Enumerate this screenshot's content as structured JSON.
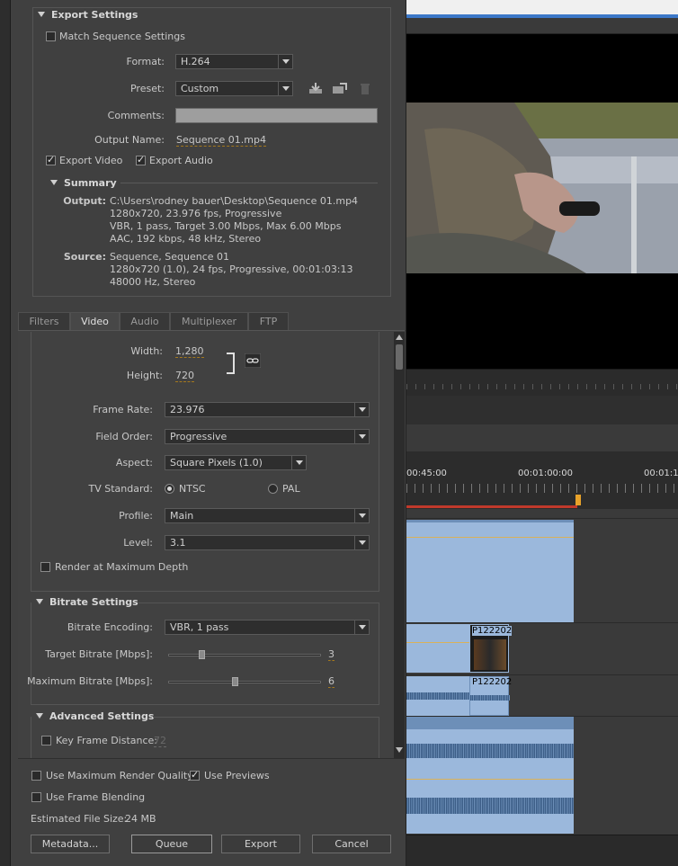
{
  "export_settings": {
    "heading": "Export Settings",
    "match_sequence_label": "Match Sequence Settings",
    "match_sequence_checked": false,
    "format_label": "Format:",
    "format_value": "H.264",
    "preset_label": "Preset:",
    "preset_value": "Custom",
    "comments_label": "Comments:",
    "comments_value": "",
    "output_name_label": "Output Name:",
    "output_name_value": "Sequence 01.mp4",
    "export_video_label": "Export Video",
    "export_video_checked": true,
    "export_audio_label": "Export Audio",
    "export_audio_checked": true
  },
  "summary": {
    "heading": "Summary",
    "output_label": "Output:",
    "output_lines": [
      "C:\\Users\\rodney bauer\\Desktop\\Sequence 01.mp4",
      "1280x720, 23.976 fps, Progressive",
      "VBR, 1 pass, Target 3.00 Mbps, Max 6.00 Mbps",
      "AAC, 192 kbps, 48 kHz, Stereo"
    ],
    "source_label": "Source:",
    "source_lines": [
      "Sequence, Sequence 01",
      "1280x720 (1.0), 24 fps, Progressive, 00:01:03:13",
      "48000 Hz, Stereo"
    ]
  },
  "tabs": [
    "Filters",
    "Video",
    "Audio",
    "Multiplexer",
    "FTP"
  ],
  "active_tab": "Video",
  "video": {
    "width_label": "Width:",
    "width_value": "1,280",
    "height_label": "Height:",
    "height_value": "720",
    "frame_rate_label": "Frame Rate:",
    "frame_rate_value": "23.976",
    "field_order_label": "Field Order:",
    "field_order_value": "Progressive",
    "aspect_label": "Aspect:",
    "aspect_value": "Square Pixels (1.0)",
    "tv_standard_label": "TV Standard:",
    "tv_ntsc_label": "NTSC",
    "tv_pal_label": "PAL",
    "tv_selected": "NTSC",
    "profile_label": "Profile:",
    "profile_value": "Main",
    "level_label": "Level:",
    "level_value": "3.1",
    "render_max_depth_label": "Render at Maximum Depth",
    "render_max_depth_checked": false
  },
  "bitrate": {
    "heading": "Bitrate Settings",
    "encoding_label": "Bitrate Encoding:",
    "encoding_value": "VBR, 1 pass",
    "target_label": "Target Bitrate [Mbps]:",
    "target_value": "3",
    "target_fraction": 0.2,
    "max_label": "Maximum Bitrate [Mbps]:",
    "max_value": "6",
    "max_fraction": 0.42
  },
  "advanced": {
    "heading": "Advanced Settings",
    "keyframe_label": "Key Frame Distance:",
    "keyframe_value": "72",
    "keyframe_checked": false
  },
  "bottom": {
    "max_render_quality_label": "Use Maximum Render Quality",
    "max_render_quality_checked": false,
    "use_previews_label": "Use Previews",
    "use_previews_checked": true,
    "frame_blending_label": "Use Frame Blending",
    "frame_blending_checked": false,
    "estimated_size_label": "Estimated File Size:",
    "estimated_size_value": "24 MB",
    "metadata_button": "Metadata...",
    "queue_button": "Queue",
    "export_button": "Export",
    "cancel_button": "Cancel"
  },
  "timeline": {
    "timecodes": [
      "00:45:00",
      "00:01:00:00",
      "00:01:1"
    ],
    "clip_labels": [
      "P122202",
      "P122202"
    ]
  },
  "colors": {
    "accent_orange": "#e8a22a",
    "clip_blue": "#9bb8dc",
    "audio_blue": "#6d8fb8",
    "panel_gray": "#404040"
  }
}
